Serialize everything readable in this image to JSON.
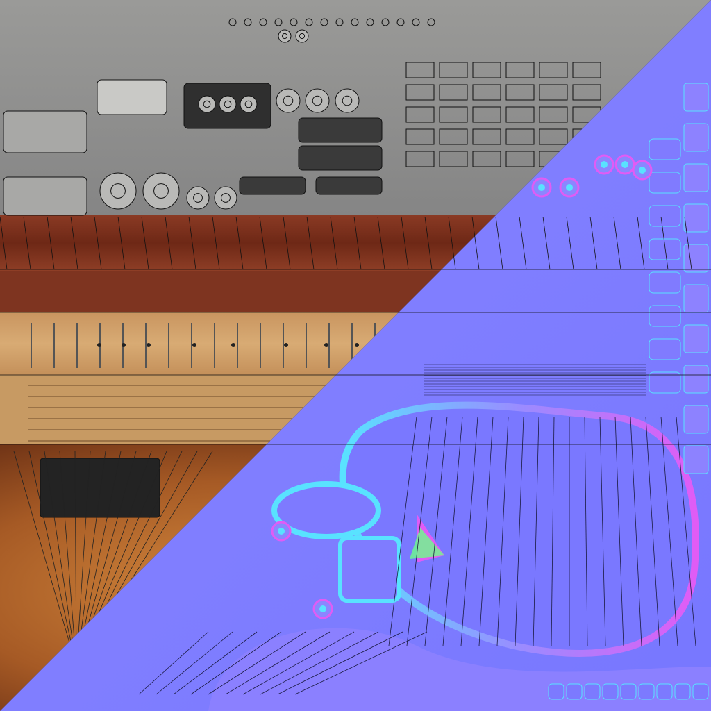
{
  "colors": {
    "metal_bg": "#8f8f8f",
    "metal_light": "#b8b8b6",
    "metal_dark": "#3b3b3b",
    "wood_dark": "#7a2e1e",
    "wood_mid": "#b56a35",
    "wood_light": "#d6a772",
    "maple": "#d3a56a",
    "pickguard": "#242424",
    "normal_base": "#7b7bff",
    "normal_light": "#9a8cff",
    "normal_cyan": "#59e2ff",
    "normal_magenta": "#e05cf5",
    "normal_green": "#6cff8a",
    "wire": "#111111"
  },
  "texture": {
    "kind": "guitar-uv-texture-atlas",
    "split": "diagonal",
    "left_half": "diffuse-albedo",
    "right_half": "tangent-normal-map"
  }
}
